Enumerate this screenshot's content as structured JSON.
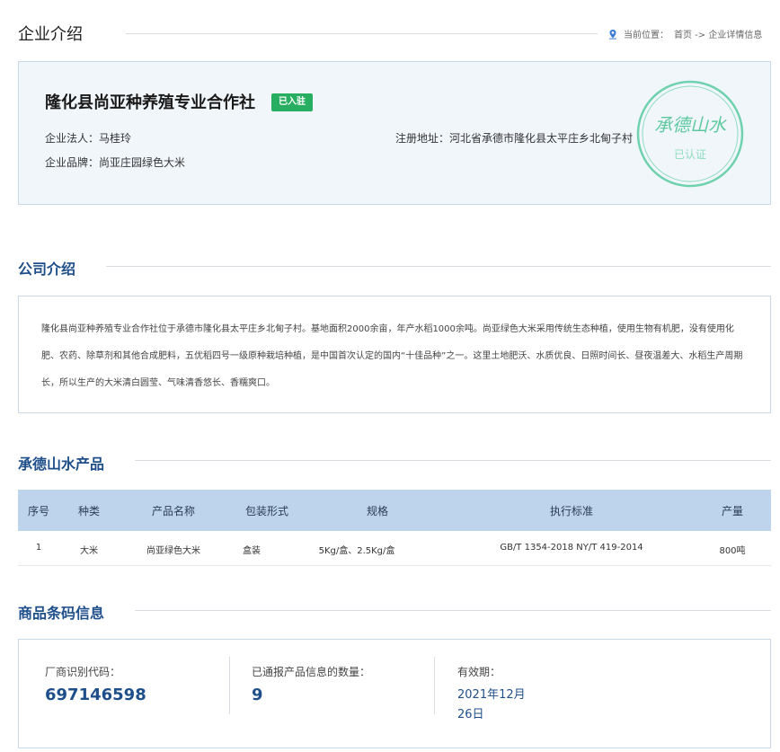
{
  "header": {
    "title": "企业介绍",
    "location_prefix": "当前位置：",
    "breadcrumb": "首页 -> 企业详情信息"
  },
  "company": {
    "name": "隆化县尚亚种养殖专业合作社",
    "badge": "已入驻",
    "legal_rep_label": "企业法人：",
    "legal_rep": "马桂玲",
    "brand_label": "企业品牌：",
    "brand": "尚亚庄园绿色大米",
    "address_label": "注册地址：",
    "address": "河北省承德市隆化县太平庄乡北甸子村",
    "seal_text": "承德山水",
    "seal_status": "已认证"
  },
  "intro": {
    "title": "公司介绍",
    "text": "隆化县尚亚种养殖专业合作社位于承德市隆化县太平庄乡北甸子村。基地面积2000余亩，年产水稻1000余吨。尚亚绿色大米采用传统生态种植，使用生物有机肥，没有使用化肥、农药、除草剂和其他合成肥料，五优稻四号一级原种栽培种植，是中国首次认定的国内“十佳品种”之一。这里土地肥沃、水质优良、日照时间长、昼夜温差大、水稻生产周期长，所以生产的大米清白圆莹、气味清香悠长、香糯爽口。"
  },
  "products": {
    "title": "承德山水产品",
    "columns": [
      "序号",
      "种类",
      "产品名称",
      "包装形式",
      "规格",
      "执行标准",
      "产量"
    ],
    "rows": [
      [
        "1",
        "大米",
        "尚亚绿色大米",
        "盒装",
        "5Kg/盒、2.5Kg/盒",
        "GB/T 1354-2018 NY/T 419-2014",
        "800吨"
      ]
    ]
  },
  "barcode": {
    "title": "商品条码信息",
    "code_label": "厂商识别代码：",
    "code": "697146598",
    "count_label": "已通报产品信息的数量：",
    "count": "9",
    "valid_label": "有效期：",
    "valid_line1": "2021年12月",
    "valid_line2": "26日"
  },
  "colors": {
    "accent_blue": "#1f4f8a",
    "badge_green": "#27ae60",
    "seal_green": "#5ec9a0",
    "table_header": "#bed3ec"
  }
}
